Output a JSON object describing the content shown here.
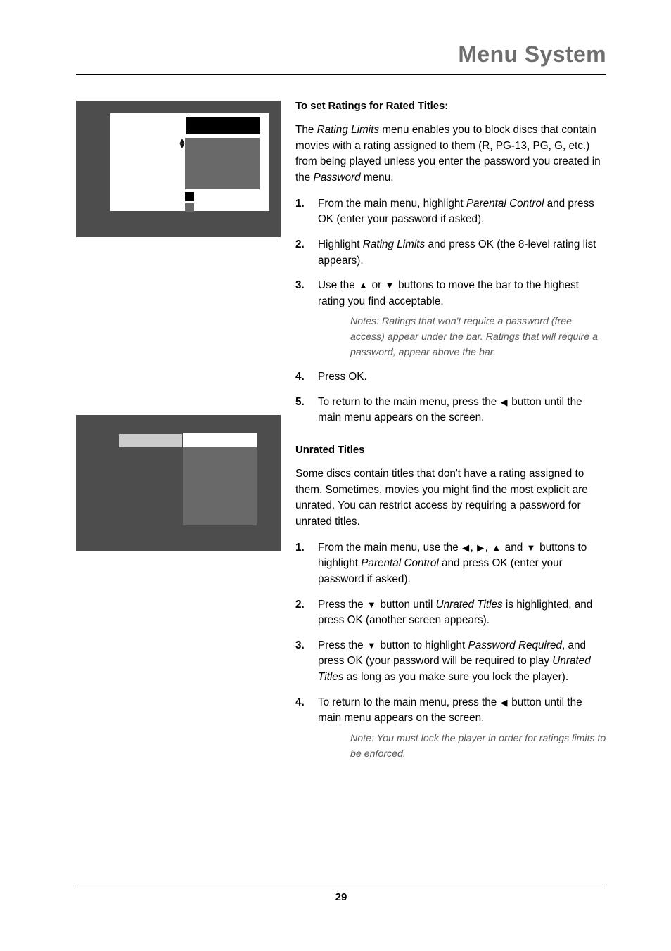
{
  "header": {
    "title": "Menu System"
  },
  "figures": [
    {
      "name": "rating-limits-menu-screenshot",
      "caption": ""
    },
    {
      "name": "unrated-titles-menu-screenshot",
      "caption": ""
    }
  ],
  "icons": {
    "up_arrow": "▲",
    "down_arrow": "▼",
    "left_arrow": "◀",
    "right_arrow": "▶",
    "scroll_up": "▲",
    "scroll_down": "▼"
  },
  "sections": [
    {
      "id": "rated-titles",
      "heading": "To set Ratings for Rated Titles:",
      "intro_segments": [
        {
          "text": "The ",
          "style": "normal"
        },
        {
          "text": "Rating Limits",
          "style": "italic"
        },
        {
          "text": " menu enables you to block discs that contain movies with a rating assigned to them (R, PG-13, PG, G, etc.) from being played unless you enter the password you created in the ",
          "style": "normal"
        },
        {
          "text": "Password",
          "style": "italic"
        },
        {
          "text": " menu.",
          "style": "normal"
        }
      ],
      "steps": [
        {
          "num": "1.",
          "segments": [
            {
              "text": "From the main menu, highlight ",
              "style": "normal"
            },
            {
              "text": "Parental Control",
              "style": "italic"
            },
            {
              "text": " and press OK (enter your password if asked).",
              "style": "normal"
            }
          ]
        },
        {
          "num": "2.",
          "segments": [
            {
              "text": "Highlight ",
              "style": "normal"
            },
            {
              "text": "Rating Limits",
              "style": "italic"
            },
            {
              "text": " and press OK (the 8-level rating list appears).",
              "style": "normal"
            }
          ]
        },
        {
          "num": "3.",
          "segments": [
            {
              "text": "Use the ",
              "style": "normal"
            },
            {
              "text": "▲",
              "style": "arrow"
            },
            {
              "text": " or ",
              "style": "normal"
            },
            {
              "text": "▼",
              "style": "arrow"
            },
            {
              "text": " buttons to move the bar to the highest rating you find acceptable.",
              "style": "normal"
            }
          ],
          "note": "Notes: Ratings that won't require a password (free access) appear under the bar. Ratings that will require a password, appear above the bar."
        },
        {
          "num": "4.",
          "segments": [
            {
              "text": "Press OK.",
              "style": "normal"
            }
          ]
        },
        {
          "num": "5.",
          "segments": [
            {
              "text": "To return to the main menu, press the ",
              "style": "normal"
            },
            {
              "text": "◀",
              "style": "arrow"
            },
            {
              "text": " button until the main menu appears on the screen.",
              "style": "normal"
            }
          ]
        }
      ]
    },
    {
      "id": "unrated-titles",
      "heading": "Unrated Titles",
      "intro_segments": [
        {
          "text": "Some discs contain titles that don't have a rating assigned to them. Sometimes, movies you might find the most explicit are unrated. You can restrict access by requiring a password for unrated titles.",
          "style": "normal"
        }
      ],
      "steps": [
        {
          "num": "1.",
          "segments": [
            {
              "text": "From the main menu, use the ",
              "style": "normal"
            },
            {
              "text": "◀",
              "style": "arrow"
            },
            {
              "text": ", ",
              "style": "normal"
            },
            {
              "text": "▶",
              "style": "arrow"
            },
            {
              "text": ", ",
              "style": "normal"
            },
            {
              "text": "▲",
              "style": "arrow"
            },
            {
              "text": " and ",
              "style": "normal"
            },
            {
              "text": "▼",
              "style": "arrow"
            },
            {
              "text": " buttons to highlight ",
              "style": "normal"
            },
            {
              "text": "Parental Control",
              "style": "italic"
            },
            {
              "text": " and press OK (enter your password if asked).",
              "style": "normal"
            }
          ]
        },
        {
          "num": "2.",
          "segments": [
            {
              "text": "Press the ",
              "style": "normal"
            },
            {
              "text": "▼",
              "style": "arrow"
            },
            {
              "text": " button until ",
              "style": "normal"
            },
            {
              "text": "Unrated Titles",
              "style": "italic"
            },
            {
              "text": " is highlighted, and press OK (another screen appears).",
              "style": "normal"
            }
          ]
        },
        {
          "num": "3.",
          "segments": [
            {
              "text": "Press the ",
              "style": "normal"
            },
            {
              "text": "▼",
              "style": "arrow"
            },
            {
              "text": " button to highlight ",
              "style": "normal"
            },
            {
              "text": "Password Required",
              "style": "italic"
            },
            {
              "text": ", and press OK (your password will be required to play ",
              "style": "normal"
            },
            {
              "text": "Unrated Titles",
              "style": "italic"
            },
            {
              "text": " as long as you make sure you lock the player).",
              "style": "normal"
            }
          ]
        },
        {
          "num": "4.",
          "segments": [
            {
              "text": "To return to the main menu, press the ",
              "style": "normal"
            },
            {
              "text": "◀",
              "style": "arrow"
            },
            {
              "text": " button until the main menu appears on the screen.",
              "style": "normal"
            }
          ],
          "note": "Note: You must lock the player in order for ratings limits to be enforced."
        }
      ]
    }
  ],
  "footer": {
    "page_number": "29"
  },
  "colors": {
    "header_gray": "#6e6e6e",
    "figure_frame": "#4d4d4d",
    "figure_gray_block": "#696969",
    "figure_light_bar": "#cccccc",
    "note_gray": "#58585a"
  }
}
